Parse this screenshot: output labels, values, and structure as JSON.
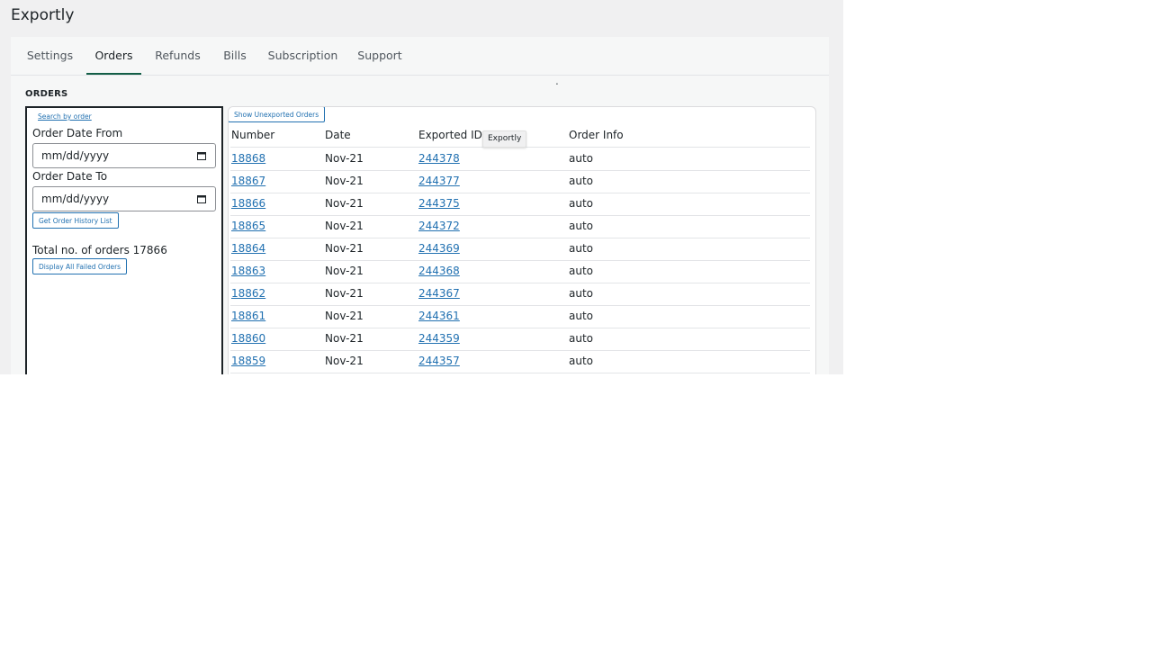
{
  "app": {
    "title": "Exportly"
  },
  "tabs": [
    {
      "label": "Settings"
    },
    {
      "label": "Orders",
      "active": true
    },
    {
      "label": "Refunds"
    },
    {
      "label": "Bills"
    },
    {
      "label": "Subscription"
    },
    {
      "label": "Support"
    }
  ],
  "stray_text": ".",
  "section": {
    "label": "ORDERS"
  },
  "search_panel": {
    "search_link": "Search by order",
    "from_label": "Order Date From",
    "from_value": "mm/dd/yyyy",
    "to_label": "Order Date To",
    "to_value": "mm/dd/yyyy",
    "get_history_button": "Get Order History List",
    "total_text": "Total no. of orders 17866",
    "failed_button": "Display All Failed Orders"
  },
  "table": {
    "show_unexported_button": "Show Unexported Orders",
    "columns": [
      "Number",
      "Date",
      "Exported ID",
      "Order Info"
    ],
    "tooltip": "Exportly",
    "rows": [
      {
        "number": "18868",
        "date": "Nov-21",
        "exported_id": "244378",
        "info": "auto"
      },
      {
        "number": "18867",
        "date": "Nov-21",
        "exported_id": "244377",
        "info": "auto"
      },
      {
        "number": "18866",
        "date": "Nov-21",
        "exported_id": "244375",
        "info": "auto"
      },
      {
        "number": "18865",
        "date": "Nov-21",
        "exported_id": "244372",
        "info": "auto"
      },
      {
        "number": "18864",
        "date": "Nov-21",
        "exported_id": "244369",
        "info": "auto"
      },
      {
        "number": "18863",
        "date": "Nov-21",
        "exported_id": "244368",
        "info": "auto"
      },
      {
        "number": "18862",
        "date": "Nov-21",
        "exported_id": "244367",
        "info": "auto"
      },
      {
        "number": "18861",
        "date": "Nov-21",
        "exported_id": "244361",
        "info": "auto"
      },
      {
        "number": "18860",
        "date": "Nov-21",
        "exported_id": "244359",
        "info": "auto"
      },
      {
        "number": "18859",
        "date": "Nov-21",
        "exported_id": "244357",
        "info": "auto"
      }
    ]
  },
  "colors": {
    "accent": "#2271b1",
    "active_tab": "#135e46",
    "background": "#f0f0f1"
  }
}
